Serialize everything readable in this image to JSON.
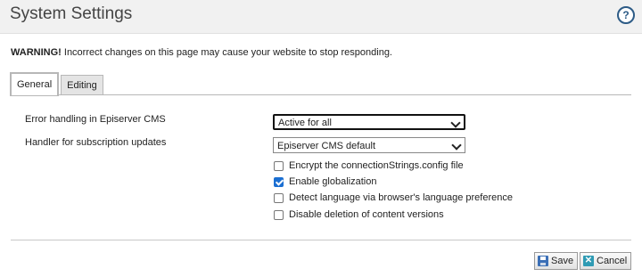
{
  "header": {
    "title": "System Settings",
    "help_glyph": "?"
  },
  "warning": {
    "strong": "WARNING!",
    "text": " Incorrect changes on this page may cause your website to stop responding."
  },
  "tabs": [
    {
      "label": "General",
      "active": true
    },
    {
      "label": "Editing",
      "active": false
    }
  ],
  "settings": {
    "error_handling": {
      "label": "Error handling in Episerver CMS",
      "selected": "Active for all"
    },
    "subscription_handler": {
      "label": "Handler for subscription updates",
      "selected": "Episerver CMS default"
    },
    "checkboxes": [
      {
        "label": "Encrypt the connectionStrings.config file",
        "checked": false
      },
      {
        "label": "Enable globalization",
        "checked": true
      },
      {
        "label": "Detect language via browser's language preference",
        "checked": false
      },
      {
        "label": "Disable deletion of content versions",
        "checked": false
      }
    ]
  },
  "footer": {
    "save_label": "Save",
    "cancel_label": "Cancel",
    "cancel_glyph": "✕"
  },
  "colors": {
    "accent": "#1b6fd2",
    "help": "#2d5b86"
  },
  "icons": [
    "help-icon",
    "chevron-down-icon",
    "save-icon",
    "cancel-icon"
  ]
}
